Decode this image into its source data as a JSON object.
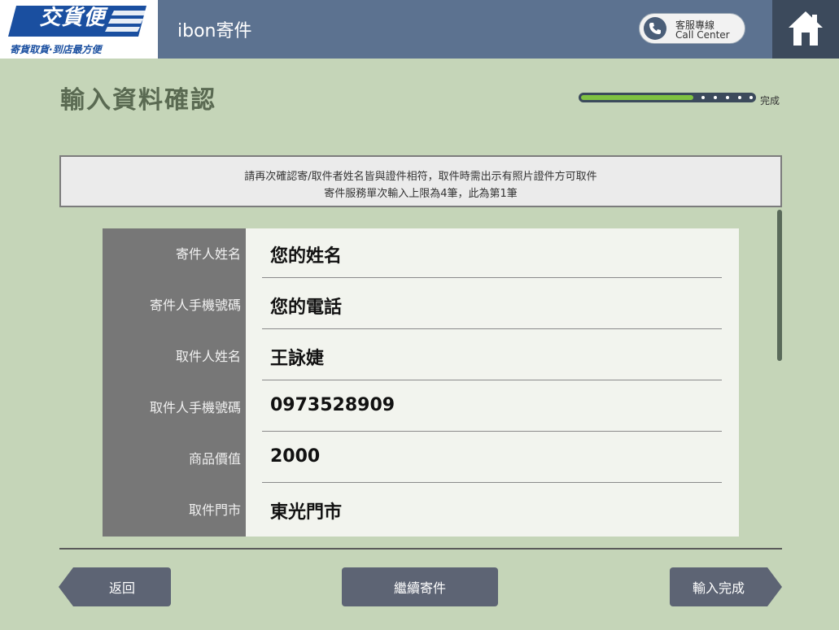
{
  "header": {
    "logo_text": "交貨便",
    "logo_slogan": "寄貨取貨·到店最方便",
    "app_title": "ibon寄件",
    "call_center_cn": "客服專線",
    "call_center_en": "Call Center",
    "colors": {
      "header_bg": "#5c7290",
      "home_bg": "#3c4a5c",
      "logo_blue": "#1a4fa0"
    }
  },
  "page": {
    "title": "輸入資料確認",
    "progress_label": "完成",
    "progress_value": 0.65
  },
  "notice": {
    "line1": "請再次確認寄/取件者姓名皆與證件相符，取件時需出示有照片證件方可取件",
    "line2": "寄件服務單次輸入上限為4筆，此為第1筆"
  },
  "form": {
    "rows": [
      {
        "label": "寄件人姓名",
        "value": "您的姓名"
      },
      {
        "label": "寄件人手機號碼",
        "value": "您的電話"
      },
      {
        "label": "取件人姓名",
        "value": "王詠婕"
      },
      {
        "label": "取件人手機號碼",
        "value": "0973528909"
      },
      {
        "label": "商品價值",
        "value": "2000"
      },
      {
        "label": "取件門市",
        "value": "東光門市"
      }
    ]
  },
  "footer": {
    "back_label": "返回",
    "continue_label": "繼續寄件",
    "done_label": "輸入完成"
  }
}
